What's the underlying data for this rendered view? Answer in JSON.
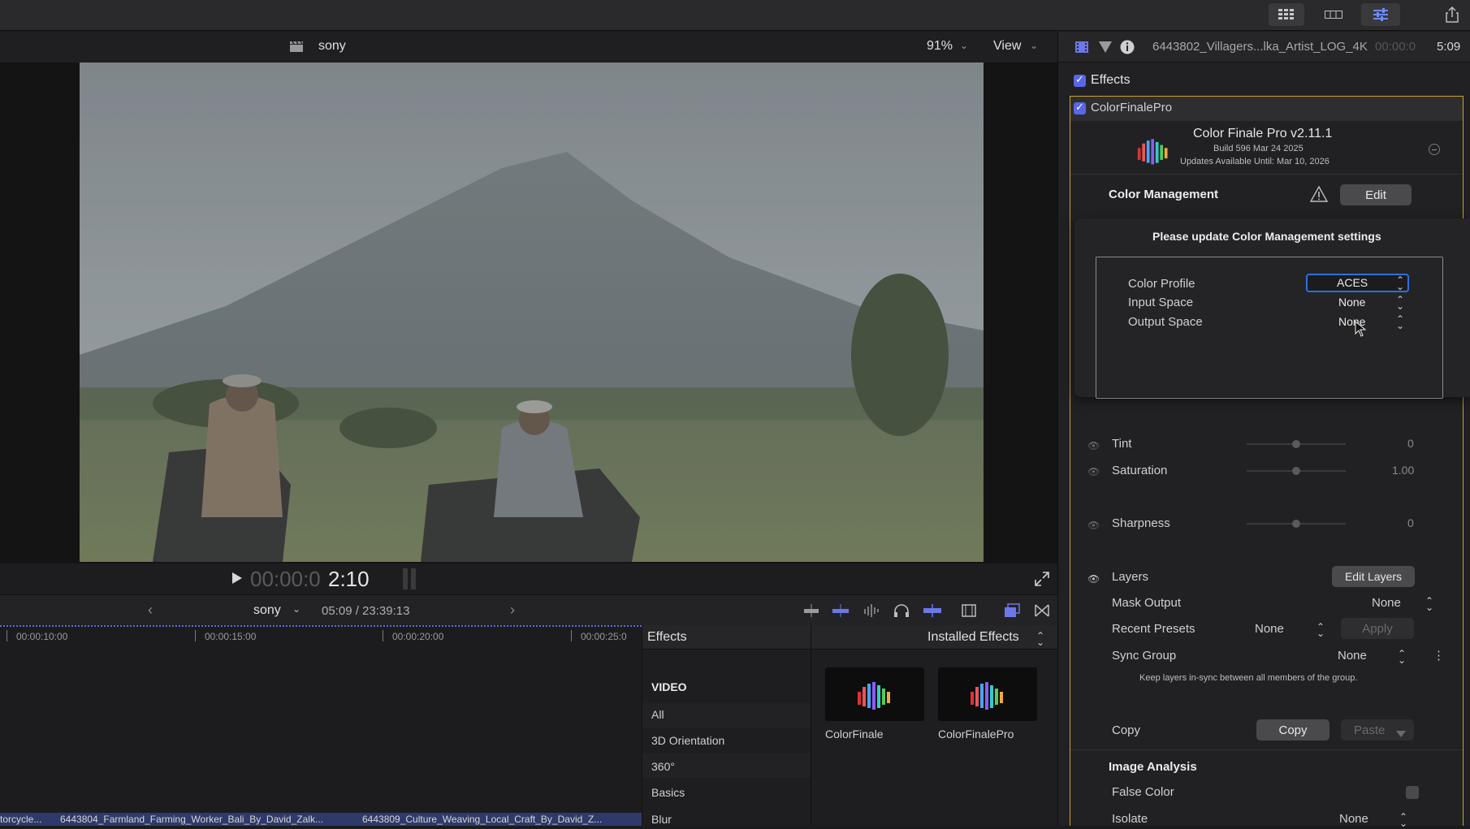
{
  "topbar": {
    "icons": [
      "grid-icon",
      "filmstrip-icon",
      "sliders-icon",
      "share-icon"
    ]
  },
  "viewer": {
    "clapper_icon": "clapper-icon",
    "project": "sony",
    "zoom": "91%",
    "view_label": "View",
    "timecode_dim": "00:00:0",
    "timecode_bright": "2:10"
  },
  "timeline": {
    "project": "sony",
    "position": "05:09 / 23:39:13",
    "ruler": [
      "00:00:10:00",
      "00:00:15:00",
      "00:00:20:00",
      "00:00:25:0"
    ],
    "clips": [
      "torcycle...",
      "6443804_Farmland_Farming_Worker_Bali_By_David_Zalk...",
      "6443809_Culture_Weaving_Local_Craft_By_David_Z..."
    ]
  },
  "effects_browser": {
    "title": "Effects",
    "installed": "Installed Effects",
    "section": "VIDEO",
    "categories": [
      "All",
      "3D Orientation",
      "360°",
      "Basics",
      "Blur"
    ],
    "thumbs": [
      "ColorFinale",
      "ColorFinalePro"
    ]
  },
  "inspector": {
    "clip_name": "6443802_Villagers...lka_Artist_LOG_4K",
    "clip_tc_dim": "00:00:0",
    "clip_tc": "5:09",
    "effects_label": "Effects",
    "plugin_name": "ColorFinalePro",
    "plugin_title": "Color Finale Pro v2.11.1",
    "build": "Build 596 Mar 24 2025",
    "updates": "Updates Available Until: Mar 10, 2026",
    "color_mgmt": "Color Management",
    "edit": "Edit",
    "popup": {
      "message": "Please update Color Management settings",
      "rows": [
        {
          "label": "Color Profile",
          "value": "ACES"
        },
        {
          "label": "Input Space",
          "value": "None"
        },
        {
          "label": "Output Space",
          "value": "None"
        }
      ]
    },
    "tint": {
      "label": "Tint",
      "value": "0"
    },
    "saturation": {
      "label": "Saturation",
      "value": "1.00"
    },
    "sharpness": {
      "label": "Sharpness",
      "value": "0"
    },
    "layers": "Layers",
    "edit_layers": "Edit Layers",
    "mask_output": {
      "label": "Mask Output",
      "value": "None"
    },
    "recent_presets": {
      "label": "Recent Presets",
      "value": "None",
      "apply": "Apply"
    },
    "sync_group": {
      "label": "Sync Group",
      "value": "None",
      "note": "Keep layers in-sync between all members of the group."
    },
    "copy_label": "Copy",
    "copy_btn": "Copy",
    "paste_btn": "Paste",
    "image_analysis": "Image Analysis",
    "false_color": "False Color",
    "isolate": {
      "label": "Isolate",
      "value": "None"
    }
  },
  "colors": {
    "accent": "#5a66e8",
    "panel_border": "#c8a62a",
    "selection_border": "#2f6fe0"
  }
}
